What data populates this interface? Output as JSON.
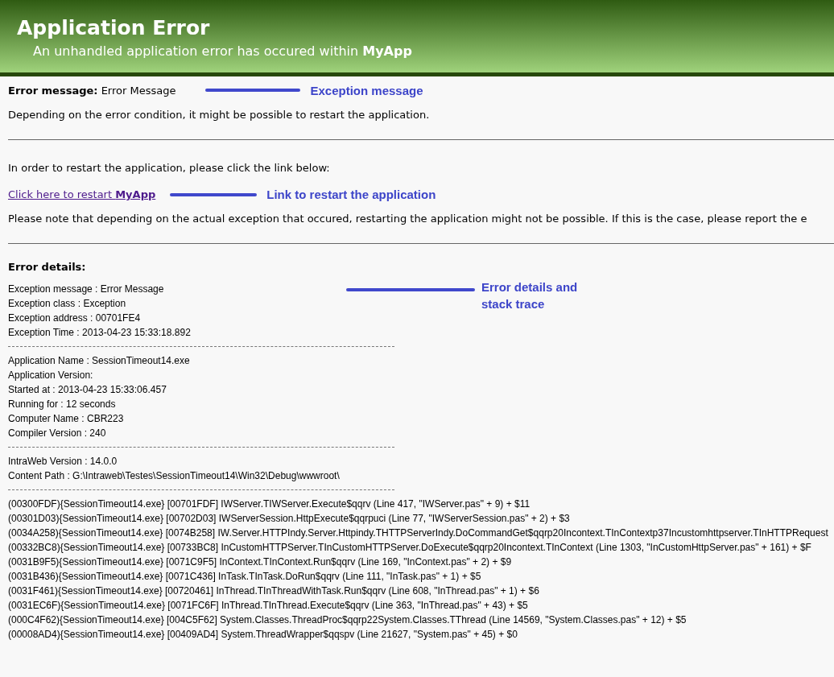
{
  "header": {
    "title": "Application Error",
    "subtitle": "An unhandled application error has occured within **MyApp**"
  },
  "error_message": {
    "label": "Error message:",
    "value": "Error Message",
    "callout": "Exception message"
  },
  "intro": "Depending on the error condition, it might be possible to restart the application.",
  "restart": {
    "instruction": "In order to restart the application, please click the link below:",
    "link": "Click here to restart **MyApp**",
    "callout": "Link to restart the application",
    "note": "Please note that depending on the actual exception that occured, restarting the application might not be possible. If this is the case, please report the e"
  },
  "details": {
    "heading": "Error details:",
    "callout": "Error details and stack trace",
    "groups": [
      [
        "Exception message : Error Message",
        "Exception class : Exception",
        "Exception address : 00701FE4",
        "Exception Time : 2013-04-23 15:33:18.892"
      ],
      [
        "Application Name : SessionTimeout14.exe",
        "Application Version:",
        "Started at : 2013-04-23 15:33:06.457",
        "Running for : 12 seconds",
        "Computer Name : CBR223",
        "Compiler Version : 240"
      ],
      [
        "IntraWeb Version : 14.0.0",
        "Content Path : G:\\Intraweb\\Testes\\SessionTimeout14\\Win32\\Debug\\wwwroot\\"
      ]
    ],
    "stack_trace": [
      "(00300FDF){SessionTimeout14.exe} [00701FDF] IWServer.TIWServer.Execute$qqrv (Line 417, \"IWServer.pas\" + 9) + $11",
      "(00301D03){SessionTimeout14.exe} [00702D03] IWServerSession.HttpExecute$qqrpuci (Line 77, \"IWServerSession.pas\" + 2) + $3",
      "(0034A258){SessionTimeout14.exe} [0074B258] IW.Server.HTTPIndy.Server.Httpindy.THTTPServerIndy.DoCommandGet$qqrp20Incontext.TInContextp37Incustomhttpserver.TInHTTPRequest",
      "(00332BC8){SessionTimeout14.exe} [00733BC8] InCustomHTTPServer.TInCustomHTTPServer.DoExecute$qqrp20Incontext.TInContext (Line 1303, \"InCustomHttpServer.pas\" + 161) + $F",
      "(0031B9F5){SessionTimeout14.exe} [0071C9F5] InContext.TInContext.Run$qqrv (Line 169, \"InContext.pas\" + 2) + $9",
      "(0031B436){SessionTimeout14.exe} [0071C436] InTask.TInTask.DoRun$qqrv (Line 111, \"InTask.pas\" + 1) + $5",
      "(0031F461){SessionTimeout14.exe} [00720461] InThread.TInThreadWithTask.Run$qqrv (Line 608, \"InThread.pas\" + 1) + $6",
      "(0031EC6F){SessionTimeout14.exe} [0071FC6F] InThread.TInThread.Execute$qqrv (Line 363, \"InThread.pas\" + 43) + $5",
      "(000C4F62){SessionTimeout14.exe} [004C5F62] System.Classes.ThreadProc$qqrp22System.Classes.TThread (Line 14569, \"System.Classes.pas\" + 12) + $5",
      "(00008AD4){SessionTimeout14.exe} [00409AD4] System.ThreadWrapper$qqspv (Line 21627, \"System.pas\" + 45) + $0"
    ]
  }
}
